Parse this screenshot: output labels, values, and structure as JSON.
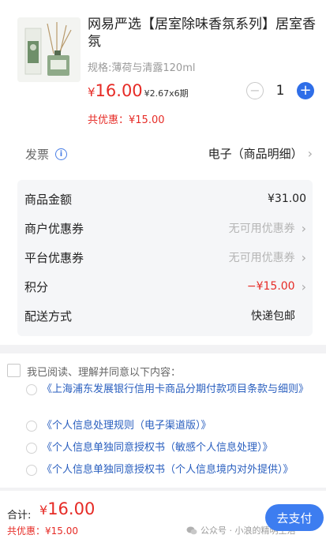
{
  "product": {
    "title": "网易严选【居室除味香氛系列】居室香氛",
    "spec": "规格:薄荷与清露120ml",
    "price_currency": "¥",
    "price_amount": "16.00",
    "installment": "¥2.67x6期",
    "promo": "共优惠：¥15.00",
    "quantity": "1",
    "minus": "−",
    "plus": "+"
  },
  "invoice": {
    "label": "发票",
    "info_glyph": "i",
    "value": "电子（商品明细）"
  },
  "summary": {
    "rows": [
      {
        "label": "商品金额",
        "value": "¥31.00"
      },
      {
        "label": "商户优惠券",
        "value": "无可用优惠券"
      },
      {
        "label": "平台优惠券",
        "value": "无可用优惠券"
      },
      {
        "label": "积分",
        "value": "−¥15.00"
      },
      {
        "label": "配送方式",
        "value": "快递包邮"
      }
    ]
  },
  "agreement": {
    "intro": "我已阅读、理解并同意以下内容：",
    "docs": [
      "《上海浦东发展银行信用卡商品分期付款项目条款与细则》",
      "《个人信息处理规则（电子渠道版）》",
      "《个人信息单独同意授权书（敏感个人信息处理）》",
      "《个人信息单独同意授权书（个人信息境内对外提供）》"
    ]
  },
  "bottom": {
    "total_label": "合计:",
    "total_currency": "¥",
    "total_amount": "16.00",
    "discount": "共优惠：¥15.00",
    "pay_label": "去支付",
    "watermark": "公众号 · 小浪的精明生活"
  },
  "glyphs": {
    "chevron": "›"
  },
  "colors": {
    "price_red": "#e62b26",
    "accent_blue": "#2f6ee8",
    "pay_blue": "#3d7df0"
  },
  "icons": [
    "info-icon",
    "chevron-right-icon",
    "wechat-icon"
  ]
}
